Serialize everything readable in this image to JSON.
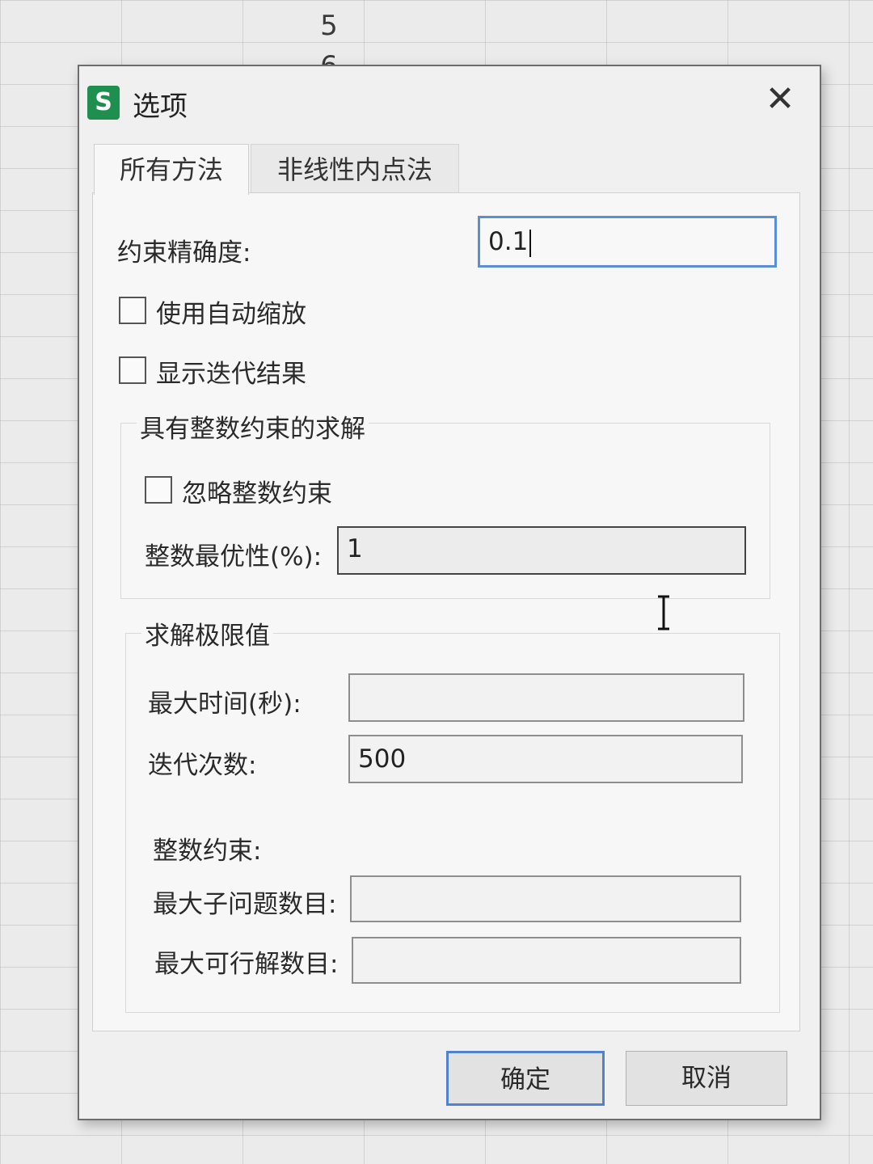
{
  "background": {
    "row_numbers": [
      "5",
      "6"
    ]
  },
  "dialog": {
    "app_icon_letter": "S",
    "title": "选项",
    "close_glyph": "✕",
    "tabs": [
      {
        "label": "所有方法",
        "active": true
      },
      {
        "label": "非线性内点法",
        "active": false
      }
    ],
    "constraint_precision": {
      "label": "约束精确度:",
      "value": "0.1"
    },
    "checkboxes": {
      "auto_scaling": {
        "label": "使用自动缩放",
        "checked": false
      },
      "show_iteration": {
        "label": "显示迭代结果",
        "checked": false
      }
    },
    "integer_group": {
      "title": "具有整数约束的求解",
      "ignore_integer": {
        "label": "忽略整数约束",
        "checked": false
      },
      "integer_optimality": {
        "label": "整数最优性(%):",
        "value": "1"
      }
    },
    "limits_group": {
      "title": "求解极限值",
      "max_time": {
        "label": "最大时间(秒):",
        "value": ""
      },
      "iterations": {
        "label": "迭代次数:",
        "value": "500"
      },
      "integer_constraints_label": "整数约束:",
      "max_subproblems": {
        "label": "最大子问题数目:",
        "value": ""
      },
      "max_feasible": {
        "label": "最大可行解数目:",
        "value": ""
      }
    },
    "buttons": {
      "ok": "确定",
      "cancel": "取消"
    }
  },
  "colors": {
    "app_icon": "#1e8f4e",
    "focus_border": "#5a8fd8"
  }
}
